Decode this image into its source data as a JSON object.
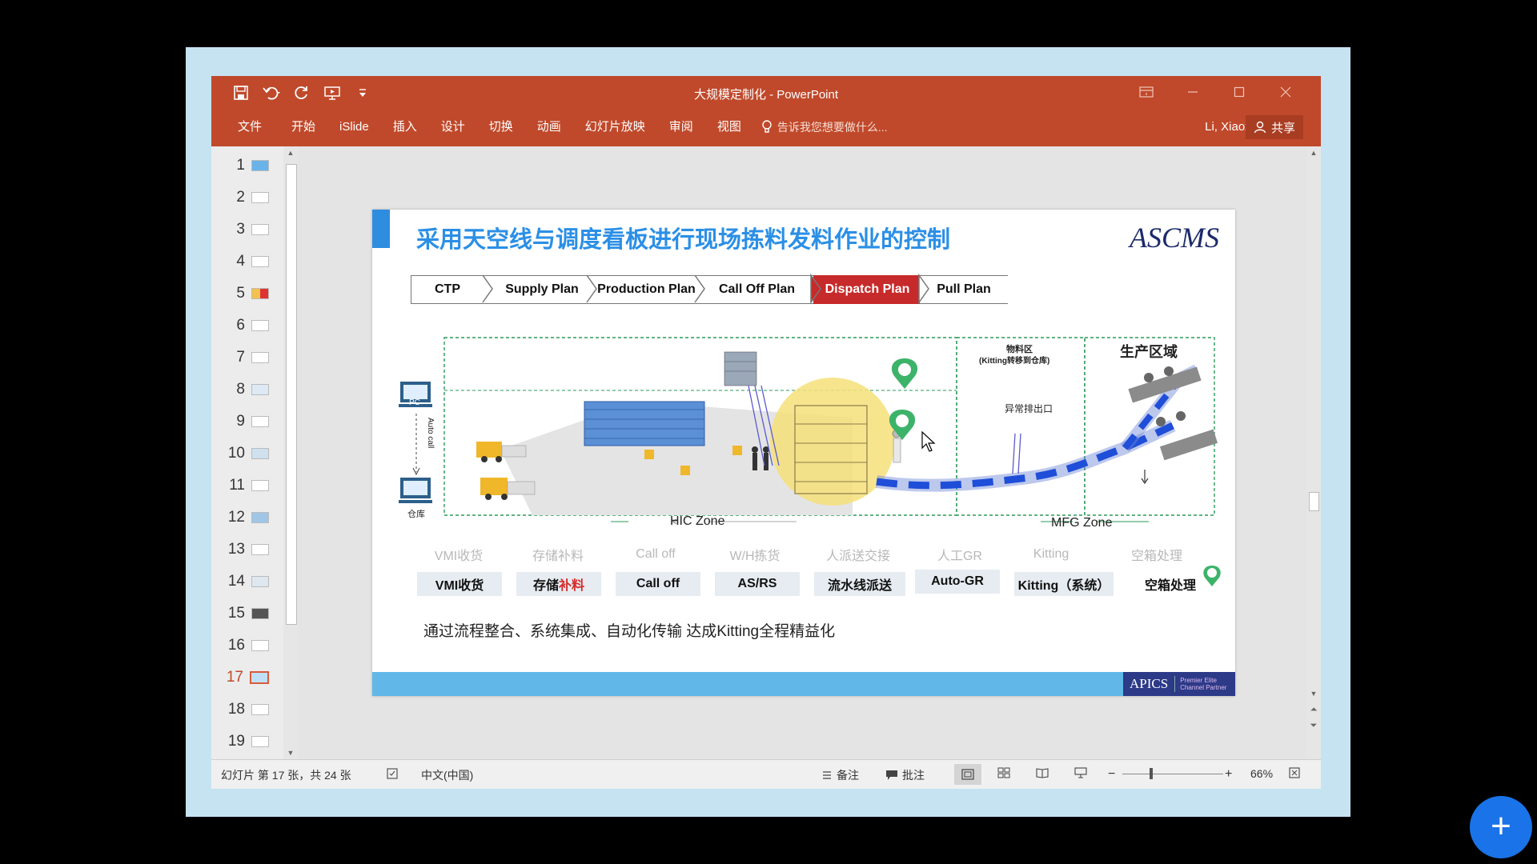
{
  "window": {
    "title": "大规模定制化 - PowerPoint",
    "user": "Li, Xiaoxi",
    "share_label": "共享"
  },
  "ribbon_tabs": [
    "文件",
    "开始",
    "iSlide",
    "插入",
    "设计",
    "切换",
    "动画",
    "幻灯片放映",
    "审阅",
    "视图"
  ],
  "tell_me": "告诉我您想要做什么...",
  "thumbnails": {
    "numbers": [
      "1",
      "2",
      "3",
      "4",
      "5",
      "6",
      "7",
      "8",
      "9",
      "10",
      "11",
      "12",
      "13",
      "14",
      "15",
      "16",
      "17",
      "18",
      "19"
    ],
    "active": "17"
  },
  "slide": {
    "title": "采用天空线与调度看板进行现场拣料发料作业的控制",
    "logo": "ASCMS",
    "chevrons": [
      "CTP",
      "Supply Plan",
      "Production Plan",
      "Call Off Plan",
      "Dispatch Plan",
      "Pull Plan"
    ],
    "active_chevron": "Dispatch Plan",
    "pc_label": "PC",
    "auto_call": "Auto call",
    "warehouse_label": "仓库",
    "material_zone": "物料区",
    "kitting_note": "(Kitting转移到仓库)",
    "production_zone": "生产区域",
    "exception_exit": "异常排出口",
    "hic_zone": "HIC Zone",
    "mfg_zone": "MFG Zone",
    "ghost_steps": [
      "VMI收货",
      "存储补料",
      "Call off",
      "W/H拣货",
      "人派送交接",
      "人工GR",
      "Kitting",
      "空箱处理"
    ],
    "steps": [
      "VMI收货",
      "存储补料",
      "Call off",
      "AS/RS",
      "流水线派送",
      "Auto-GR",
      "Kitting（系统）",
      "空箱处理"
    ],
    "footer_text": "通过流程整合、系统集成、自动化传输 达成Kitting全程精益化",
    "apics_mark": "APICS",
    "apics_sub": "Premier Elite Channel Partner"
  },
  "status": {
    "slide_info": "幻灯片 第 17 张，共 24 张",
    "language": "中文(中国)",
    "notes": "备注",
    "comments": "批注",
    "zoom": "66%"
  },
  "colors": {
    "ribbon": "#c0492b",
    "accent_blue": "#2b8fe6",
    "dispatch_red": "#c72a2a",
    "zone_green": "#2e9a5a",
    "fab_blue": "#1a73e8"
  }
}
